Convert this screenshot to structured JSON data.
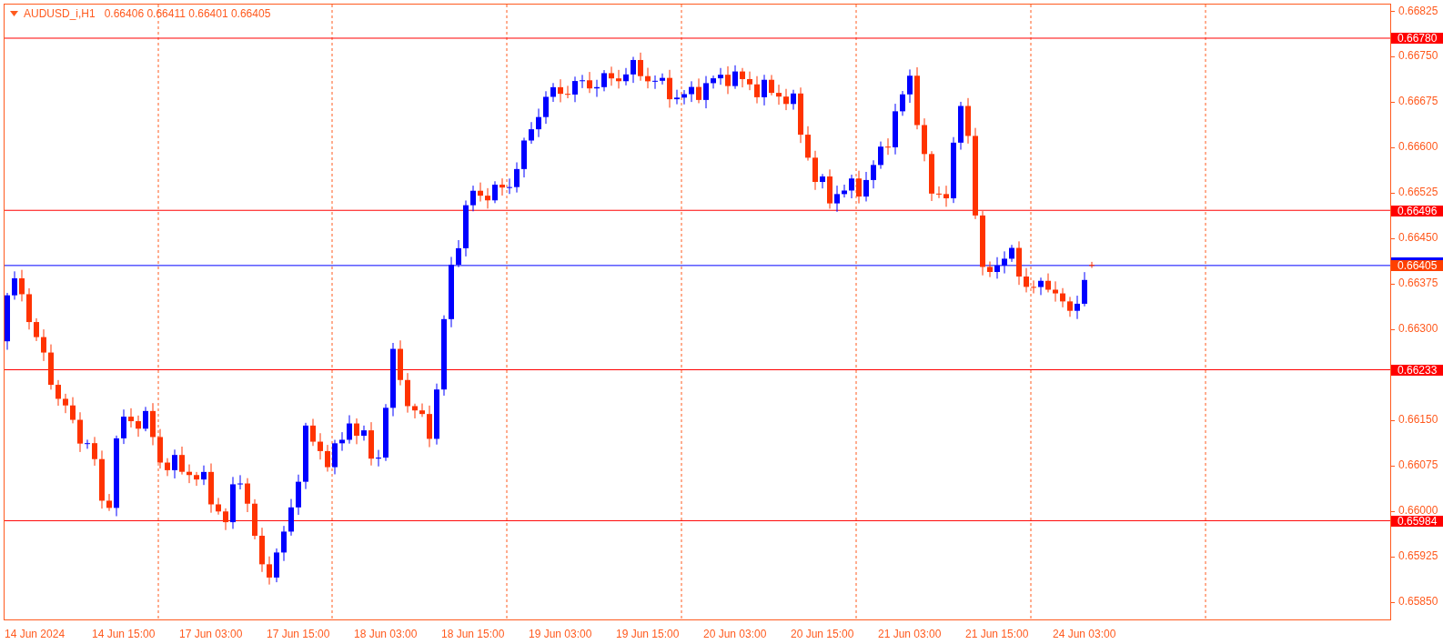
{
  "header": {
    "symbol": "AUDUSD_i,H1",
    "quotes": [
      "0.66406",
      "0.66411",
      "0.66401",
      "0.66405"
    ]
  },
  "price_axis": {
    "ticks": [
      "0.66825",
      "0.66750",
      "0.66675",
      "0.66600",
      "0.66525",
      "0.66450",
      "0.66375",
      "0.66300",
      "0.66150",
      "0.66075",
      "0.66000",
      "0.65925",
      "0.65850"
    ]
  },
  "price_lines": [
    {
      "label": "0.66780",
      "kind": "level"
    },
    {
      "label": "0.66496",
      "kind": "level"
    },
    {
      "label": "0.66405",
      "kind": "bid"
    },
    {
      "label": "0.66233",
      "kind": "level"
    },
    {
      "label": "0.65984",
      "kind": "level"
    }
  ],
  "time_axis": {
    "labels": [
      "14 Jun 2024",
      "14 Jun 15:00",
      "17 Jun 03:00",
      "17 Jun 15:00",
      "18 Jun 03:00",
      "18 Jun 15:00",
      "19 Jun 03:00",
      "19 Jun 15:00",
      "20 Jun 03:00",
      "20 Jun 15:00",
      "21 Jun 03:00",
      "21 Jun 15:00",
      "24 Jun 03:00"
    ]
  }
}
